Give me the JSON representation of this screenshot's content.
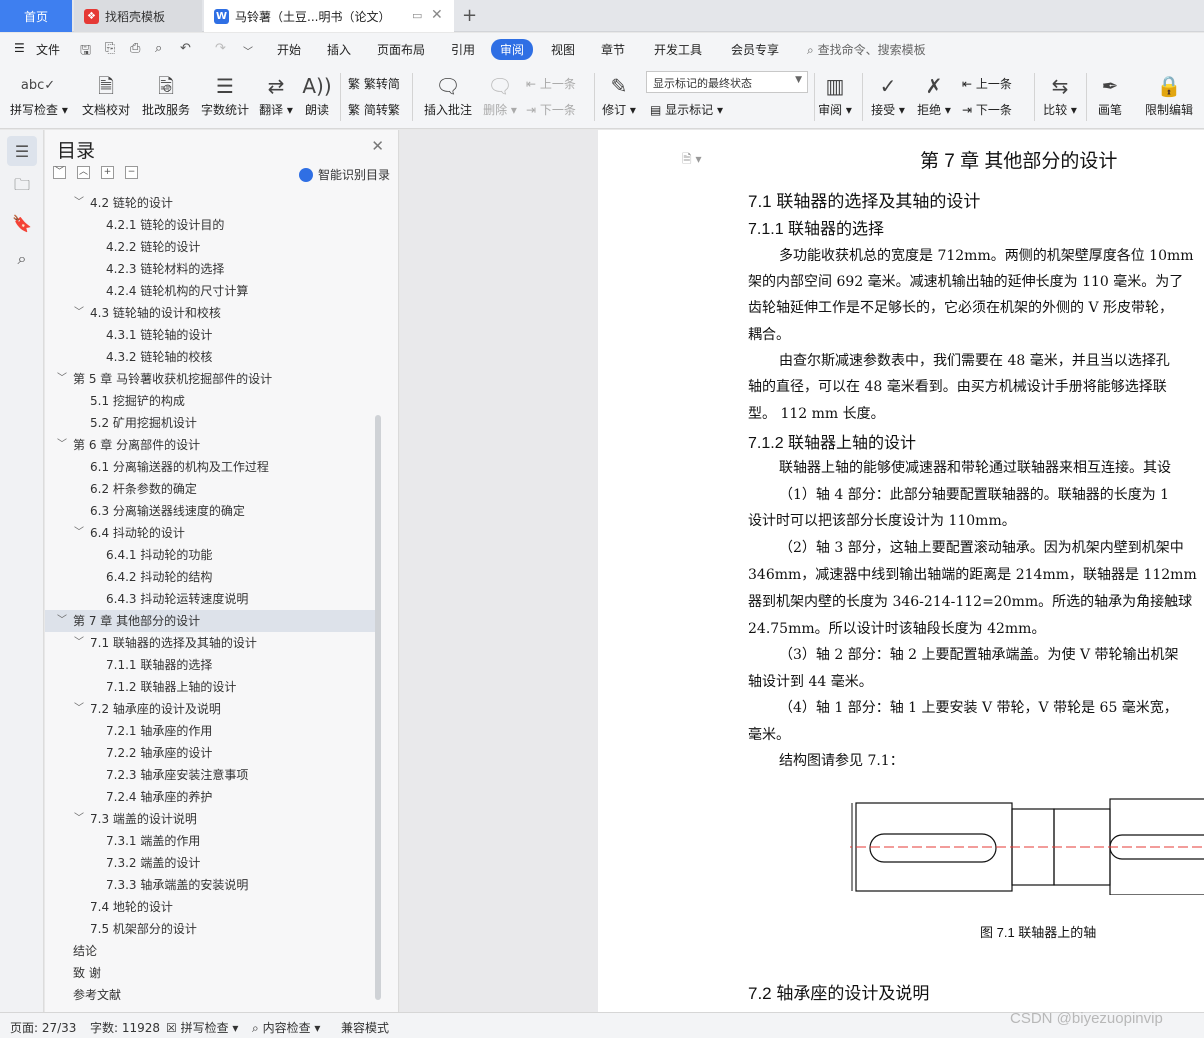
{
  "tabs": {
    "home": "首页",
    "template": "找稻壳模板",
    "doc": "马铃薯（土豆...明书（论文）"
  },
  "menu": {
    "file": "文件",
    "items": [
      "开始",
      "插入",
      "页面布局",
      "引用",
      "审阅",
      "视图",
      "章节",
      "开发工具",
      "会员专享"
    ],
    "active": "审阅",
    "search": "查找命令、搜索模板"
  },
  "toolbar": {
    "spell": "拼写检查",
    "proof": "文档校对",
    "annotate": "批改服务",
    "wordcount": "字数统计",
    "translate": "翻译",
    "read": "朗读",
    "trad": "繁转简",
    "simp": "简转繁",
    "insert_comment": "插入批注",
    "delete": "删除",
    "prev": "上一条",
    "next": "下一条",
    "revise": "修订",
    "status_value": "显示标记的最终状态",
    "show_marks": "显示标记",
    "review": "审阅",
    "accept": "接受",
    "reject": "拒绝",
    "prev2": "上一条",
    "next2": "下一条",
    "compare": "比较",
    "pen": "画笔",
    "restrict": "限制编辑"
  },
  "toc": {
    "title": "目录",
    "smart": "智能识别目录",
    "items": [
      {
        "text": "4.2  链轮的设计",
        "level": 2,
        "arrow": "﹀"
      },
      {
        "text": "4.2.1  链轮的设计目的",
        "level": 3
      },
      {
        "text": "4.2.2  链轮的设计",
        "level": 3
      },
      {
        "text": "4.2.3  链轮材料的选择",
        "level": 3
      },
      {
        "text": "4.2.4  链轮机构的尺寸计算",
        "level": 3
      },
      {
        "text": "4.3  链轮轴的设计和校核",
        "level": 2,
        "arrow": "﹀"
      },
      {
        "text": "4.3.1  链轮轴的设计",
        "level": 3
      },
      {
        "text": "4.3.2  链轮轴的校核",
        "level": 3
      },
      {
        "text": "第 5 章  马铃薯收获机挖掘部件的设计",
        "level": 1,
        "arrow": "﹀"
      },
      {
        "text": "5.1  挖掘铲的构成",
        "level": 2
      },
      {
        "text": "5.2  矿用挖掘机设计",
        "level": 2
      },
      {
        "text": "第 6 章  分离部件的设计",
        "level": 1,
        "arrow": "﹀"
      },
      {
        "text": "6.1  分离输送器的机构及工作过程",
        "level": 2
      },
      {
        "text": "6.2  杆条参数的确定",
        "level": 2
      },
      {
        "text": "6.3  分离输送器线速度的确定",
        "level": 2
      },
      {
        "text": "6.4  抖动轮的设计",
        "level": 2,
        "arrow": "﹀"
      },
      {
        "text": "6.4.1  抖动轮的功能",
        "level": 3
      },
      {
        "text": "6.4.2  抖动轮的结构",
        "level": 3
      },
      {
        "text": "6.4.3  抖动轮运转速度说明",
        "level": 3
      },
      {
        "text": "第 7 章  其他部分的设计",
        "level": 1,
        "arrow": "﹀",
        "selected": true
      },
      {
        "text": "7.1 联轴器的选择及其轴的设计",
        "level": 2,
        "arrow": "﹀"
      },
      {
        "text": "7.1.1  联轴器的选择",
        "level": 3
      },
      {
        "text": "7.1.2  联轴器上轴的设计",
        "level": 3
      },
      {
        "text": "7.2  轴承座的设计及说明",
        "level": 2,
        "arrow": "﹀"
      },
      {
        "text": "7.2.1 轴承座的作用",
        "level": 3
      },
      {
        "text": "7.2.2  轴承座的设计",
        "level": 3
      },
      {
        "text": "7.2.3  轴承座安装注意事项",
        "level": 3
      },
      {
        "text": "7.2.4  轴承座的养护",
        "level": 3
      },
      {
        "text": "7.3  端盖的设计说明",
        "level": 2,
        "arrow": "﹀"
      },
      {
        "text": "7.3.1  端盖的作用",
        "level": 3
      },
      {
        "text": "7.3.2  端盖的设计",
        "level": 3
      },
      {
        "text": "7.3.3  轴承端盖的安装说明",
        "level": 3
      },
      {
        "text": "7.4  地轮的设计",
        "level": 2
      },
      {
        "text": "7.5  机架部分的设计",
        "level": 2
      },
      {
        "text": "结论",
        "level": 1
      },
      {
        "text": "致    谢",
        "level": 1
      },
      {
        "text": "参考文献",
        "level": 1
      }
    ]
  },
  "document": {
    "chapter": "第 7 章  其他部分的设计",
    "h_7_1": "7.1 联轴器的选择及其轴的设计",
    "h_7_1_1": "7.1.1  联轴器的选择",
    "p1_l1": "多功能收获机总的宽度是 712mm。两侧的机架壁厚度各位 10mm",
    "p1_l2": "架的内部空间 692 毫米。减速机输出轴的延伸长度为 110 毫米。为了",
    "p1_l3": "齿轮轴延伸工作是不足够长的，它必须在机架的外侧的 V 形皮带轮，",
    "p1_l4": "耦合。",
    "p2_l1": "由查尔斯减速参数表中，我们需要在 48 毫米，并且当以选择孔",
    "p2_l2": "轴的直径，可以在 48 毫米看到。由买方机械设计手册将能够选择联",
    "p2_l3": "型。 112 mm 长度。",
    "h_7_1_2": "7.1.2  联轴器上轴的设计",
    "p3_l1": "联轴器上轴的能够使减速器和带轮通过联轴器来相互连接。其设",
    "p4_l1": "（1）轴 4 部分：此部分轴要配置联轴器的。联轴器的长度为 1",
    "p4_l2": "设计时可以把该部分长度设计为 110mm。",
    "p5_l1": "（2）轴 3 部分，这轴上要配置滚动轴承。因为机架内壁到机架中",
    "p5_l2": "346mm，减速器中线到输出轴端的距离是 214mm，联轴器是 112mm",
    "p5_l3": "器到机架内壁的长度为 346-214-112=20mm。所选的轴承为角接触球",
    "p5_l4": "24.75mm。所以设计时该轴段长度为 42mm。",
    "p6_l1": "（3）轴 2 部分：轴 2 上要配置轴承端盖。为使 V 带轮输出机架",
    "p6_l2": "轴设计到 44 毫米。",
    "p7_l1": "（4）轴 1 部分：轴 1 上要安装 V 带轮，V 带轮是 65 毫米宽，",
    "p7_l2": "毫米。",
    "p8_l1": "结构图请参见 7.1：",
    "caption": "图 7.1  联轴器上的轴",
    "h_7_2": "7.2  轴承座的设计及说明"
  },
  "status": {
    "page": "页面: 27/33",
    "words": "字数: 11928",
    "spell": "拼写检查",
    "content": "内容检查",
    "compat": "兼容模式"
  },
  "watermark": "CSDN @biyezuopinvip",
  "colors": {
    "accent": "#2f6fe4",
    "tab_home": "#3e7ff0",
    "centerline": "#e53935"
  }
}
